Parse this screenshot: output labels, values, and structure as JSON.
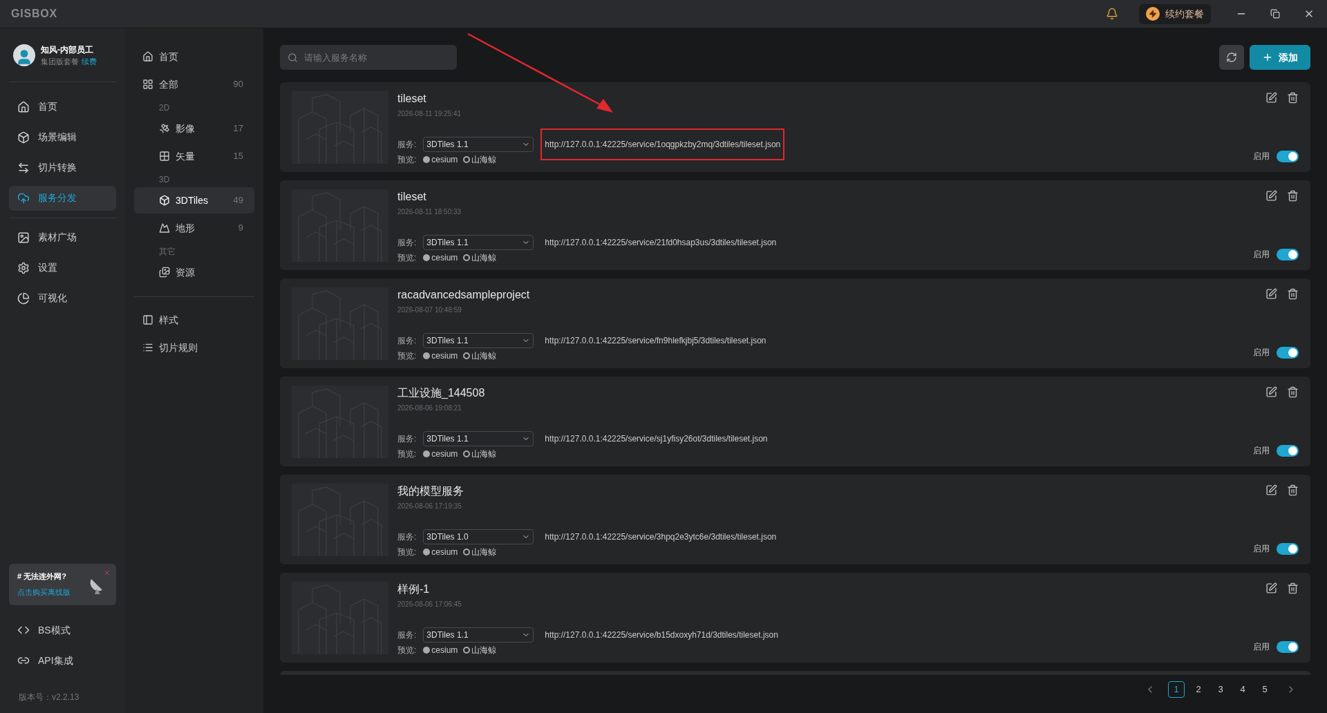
{
  "app": {
    "logo": "GISBOX",
    "renew_label": "续约套餐"
  },
  "user": {
    "name": "知风-内部员工",
    "plan": "集团版套餐",
    "renew_link": "续费"
  },
  "nav": [
    {
      "label": "首页",
      "selected": false
    },
    {
      "label": "场景编辑",
      "selected": false
    },
    {
      "label": "切片转换",
      "selected": false
    },
    {
      "label": "服务分发",
      "selected": true
    },
    {
      "label": "素材广场",
      "selected": false
    },
    {
      "label": "设置",
      "selected": false
    },
    {
      "label": "可视化",
      "selected": false
    }
  ],
  "promo": {
    "title": "# 无法连外网?",
    "link": "点击购买离线版"
  },
  "bottom_nav": [
    {
      "label": "BS模式"
    },
    {
      "label": "API集成"
    }
  ],
  "version": "版本号：v2.2.13",
  "categories": [
    {
      "label": "首页",
      "selected": false
    },
    {
      "label": "全部",
      "count": "90",
      "selected": false,
      "children": [
        {
          "group": "2D",
          "children": [
            {
              "label": "影像",
              "count": "17",
              "selected": false
            },
            {
              "label": "矢量",
              "count": "15",
              "selected": false
            }
          ]
        },
        {
          "group": "3D",
          "children": [
            {
              "label": "3DTiles",
              "count": "49",
              "selected": true
            },
            {
              "label": "地形",
              "count": "9",
              "selected": false
            }
          ]
        },
        {
          "group": "其它",
          "children": [
            {
              "label": "资源",
              "selected": false
            }
          ]
        }
      ]
    }
  ],
  "tools": [
    {
      "label": "样式"
    },
    {
      "label": "切片规则"
    }
  ],
  "search": {
    "placeholder": "请输入服务名称"
  },
  "add_button": "添加",
  "services": [
    {
      "name": "tileset",
      "time": "2026-08-11 19:25:41",
      "service_label": "服务:",
      "version": "3DTiles 1.1",
      "url": "http://127.0.0.1:42225/service/1oqgpkzby2mq/3dtiles/tileset.json",
      "preview_label": "预览:",
      "cesium": "cesium",
      "shanhaijing": "山海鲸",
      "enabled_label": "启用",
      "on": true,
      "highlighted": true
    },
    {
      "name": "tileset",
      "time": "2026-08-11 18:50:33",
      "service_label": "服务:",
      "version": "3DTiles 1.1",
      "url": "http://127.0.0.1:42225/service/21fd0hsap3us/3dtiles/tileset.json",
      "preview_label": "预览:",
      "cesium": "cesium",
      "shanhaijing": "山海鲸",
      "enabled_label": "启用",
      "on": true,
      "highlighted": false
    },
    {
      "name": "racadvancedsampleproject",
      "time": "2026-08-07 10:48:59",
      "service_label": "服务:",
      "version": "3DTiles 1.1",
      "url": "http://127.0.0.1:42225/service/fn9hlefkjbj5/3dtiles/tileset.json",
      "preview_label": "预览:",
      "cesium": "cesium",
      "shanhaijing": "山海鲸",
      "enabled_label": "启用",
      "on": true,
      "highlighted": false
    },
    {
      "name": "工业设施_144508",
      "time": "2026-08-06 19:08:21",
      "service_label": "服务:",
      "version": "3DTiles 1.1",
      "url": "http://127.0.0.1:42225/service/sj1yfisy26ot/3dtiles/tileset.json",
      "preview_label": "预览:",
      "cesium": "cesium",
      "shanhaijing": "山海鲸",
      "enabled_label": "启用",
      "on": true,
      "highlighted": false
    },
    {
      "name": "我的模型服务",
      "time": "2026-08-06 17:19:35",
      "service_label": "服务:",
      "version": "3DTiles 1.0",
      "url": "http://127.0.0.1:42225/service/3hpq2e3ytc6e/3dtiles/tileset.json",
      "preview_label": "预览:",
      "cesium": "cesium",
      "shanhaijing": "山海鲸",
      "enabled_label": "启用",
      "on": true,
      "highlighted": false
    },
    {
      "name": "样例-1",
      "time": "2026-08-06 17:06:45",
      "service_label": "服务:",
      "version": "3DTiles 1.1",
      "url": "http://127.0.0.1:42225/service/b15dxoxyh71d/3dtiles/tileset.json",
      "preview_label": "预览:",
      "cesium": "cesium",
      "shanhaijing": "山海鲸",
      "enabled_label": "启用",
      "on": true,
      "highlighted": false
    }
  ],
  "pagination": [
    {
      "label": "1",
      "selected": true
    },
    {
      "label": "2",
      "selected": false
    },
    {
      "label": "3",
      "selected": false
    },
    {
      "label": "4",
      "selected": false
    },
    {
      "label": "5",
      "selected": false
    }
  ]
}
